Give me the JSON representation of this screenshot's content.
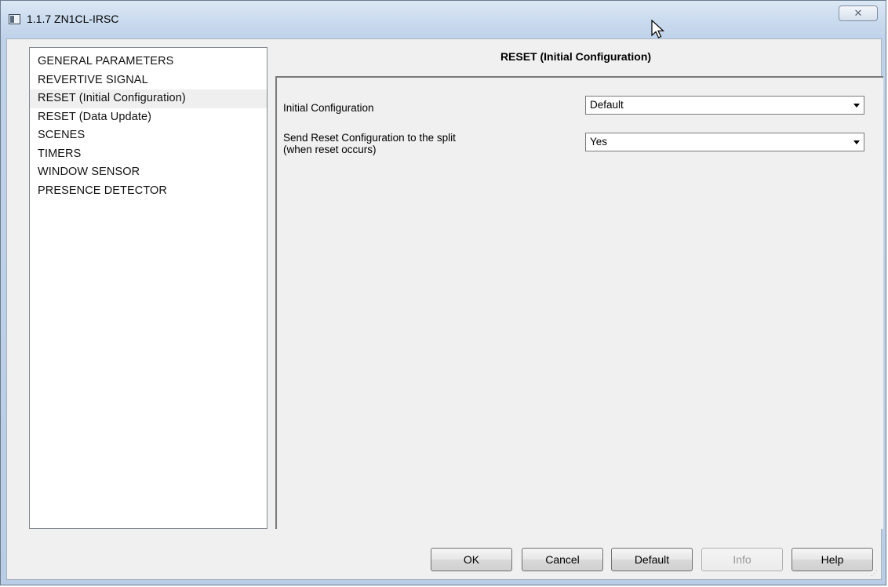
{
  "window": {
    "title": "1.1.7 ZN1CL-IRSC",
    "close_glyph": "✕"
  },
  "nav": {
    "items": [
      {
        "label": "GENERAL PARAMETERS"
      },
      {
        "label": "REVERTIVE SIGNAL"
      },
      {
        "label": "RESET (Initial Configuration)",
        "selected": true
      },
      {
        "label": "RESET (Data Update)"
      },
      {
        "label": "SCENES"
      },
      {
        "label": "TIMERS"
      },
      {
        "label": "WINDOW SENSOR"
      },
      {
        "label": "PRESENCE DETECTOR"
      }
    ]
  },
  "content": {
    "title": "RESET (Initial Configuration)",
    "params": [
      {
        "label_line1": "Initial Configuration",
        "label_line2": "",
        "value": "Default"
      },
      {
        "label_line1": "Send Reset Configuration to the split",
        "label_line2": "(when reset occurs)",
        "value": "Yes"
      }
    ]
  },
  "buttons": {
    "ok": "OK",
    "cancel": "Cancel",
    "default": "Default",
    "info": "Info",
    "help": "Help"
  },
  "icons": {
    "app": "window-app-icon",
    "close": "close-icon",
    "cursor": "mouse-cursor-icon",
    "dropdown": "chevron-down-icon"
  }
}
